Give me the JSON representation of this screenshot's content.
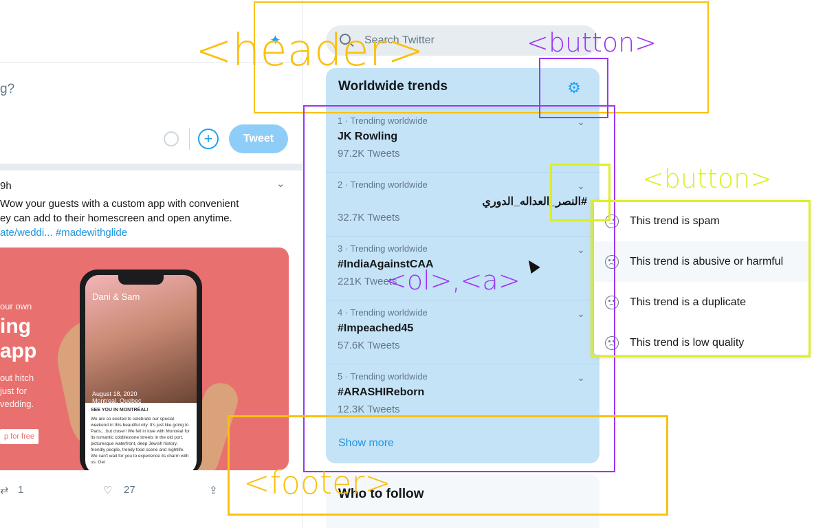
{
  "feed": {
    "composer_placeholder": "g?",
    "add_icon": "plus-circle-icon",
    "tweet_button": "Tweet",
    "tweet": {
      "time": "9h",
      "text_line1": "Wow your guests with a custom app with convenient",
      "text_line2": "ey can add to their homescreen and open anytime.",
      "link_text": "ate/weddi... #madewithglide",
      "media": {
        "line1": "our own",
        "line2": "ing",
        "line3": "app",
        "line4": "out hitch",
        "line5": "just for",
        "line6": "vedding.",
        "cta": "p for free",
        "phone_title": "Dani & Sam",
        "phone_date": "August 18, 2020",
        "phone_location": "Montreal, Quebec",
        "phone_heading": "SEE YOU IN MONTRÉAL!",
        "phone_body": "We are so excited to celebrate our special weekend in this beautiful city. It's just like going to Paris... but closer! We fell in love with Montréal for its romantic cobblestone streets in the old port, picturesque waterfront, deep Jewish history, friendly people, trendy food scene and nightlife. We can't wait for you to experience its charm with us. Get"
      },
      "retweets": "1",
      "likes": "27"
    }
  },
  "sidebar": {
    "search_placeholder": "Search Twitter",
    "trends_title": "Worldwide trends",
    "trends": [
      {
        "meta": "1 · Trending worldwide",
        "name": "JK Rowling",
        "count": "97.2K Tweets"
      },
      {
        "meta": "2 · Trending worldwide",
        "name": "#النصر_العداله_الدوري",
        "count": "32.7K Tweets"
      },
      {
        "meta": "3 · Trending worldwide",
        "name": "#IndiaAgainstCAA",
        "count": "221K Tweets"
      },
      {
        "meta": "4 · Trending worldwide",
        "name": "#Impeached45",
        "count": "57.6K Tweets"
      },
      {
        "meta": "5 · Trending worldwide",
        "name": "#ARASHIReborn",
        "count": "12.3K Tweets"
      }
    ],
    "show_more": "Show more",
    "who_to_follow": "Who to follow"
  },
  "dropdown": {
    "items": [
      "This trend is spam",
      "This trend is abusive or harmful",
      "This trend is a duplicate",
      "This trend is low quality"
    ]
  },
  "annotations": {
    "header": "<header>",
    "button_top": "<button>",
    "ol_a": "<ol>,<a>",
    "button_right": "<button>",
    "footer": "<footer>"
  },
  "colors": {
    "annotation_yellow": "#fac011",
    "annotation_purple": "#9b35f5",
    "annotation_lime": "#dcee24",
    "twitter_blue": "#1da1f2",
    "trends_bg": "#c4e3f7"
  }
}
